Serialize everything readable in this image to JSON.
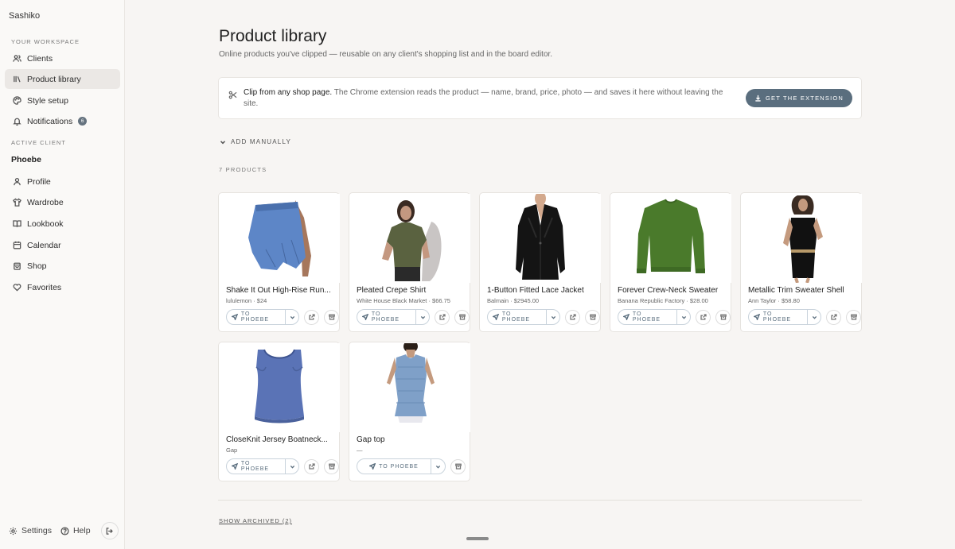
{
  "app": {
    "brand": "Sashiko"
  },
  "sidebar": {
    "workspace_label": "YOUR WORKSPACE",
    "workspace_items": [
      {
        "label": "Clients",
        "icon": "users-icon"
      },
      {
        "label": "Product library",
        "icon": "library-icon",
        "active": true
      },
      {
        "label": "Style setup",
        "icon": "palette-icon"
      },
      {
        "label": "Notifications",
        "icon": "bell-icon",
        "badge": "6"
      }
    ],
    "active_client_label": "ACTIVE CLIENT",
    "client_name": "Phoebe",
    "client_items": [
      {
        "label": "Profile",
        "icon": "user-icon"
      },
      {
        "label": "Wardrobe",
        "icon": "shirt-icon"
      },
      {
        "label": "Lookbook",
        "icon": "book-icon"
      },
      {
        "label": "Calendar",
        "icon": "calendar-icon"
      },
      {
        "label": "Shop",
        "icon": "shopping-bag-icon"
      },
      {
        "label": "Favorites",
        "icon": "heart-icon"
      }
    ],
    "footer": {
      "settings": "Settings",
      "help": "Help"
    }
  },
  "page": {
    "title": "Product library",
    "subtitle": "Online products you've clipped — reusable on any client's shopping list and in the board editor."
  },
  "banner": {
    "lead": "Clip from any shop page.",
    "text": " The Chrome extension reads the product — name, brand, price, photo — and saves it here without leaving the site.",
    "button": "GET THE EXTENSION"
  },
  "add_manually": "ADD MANUALLY",
  "product_count": "7 PRODUCTS",
  "products": [
    {
      "name": "Shake It Out High-Rise Run...",
      "meta": "lululemon · $24",
      "send_label": "TO PHOEBE",
      "image": "blue-shorts"
    },
    {
      "name": "Pleated Crepe Shirt",
      "meta": "White House Black Market · $66.75",
      "send_label": "TO PHOEBE",
      "image": "olive-shirt"
    },
    {
      "name": "1-Button Fitted Lace Jacket",
      "meta": "Balmain · $2945.00",
      "send_label": "TO PHOEBE",
      "image": "black-jacket"
    },
    {
      "name": "Forever Crew-Neck Sweater",
      "meta": "Banana Republic Factory · $28.00",
      "send_label": "TO PHOEBE",
      "image": "green-sweater"
    },
    {
      "name": "Metallic Trim Sweater Shell",
      "meta": "Ann Taylor · $58.80",
      "send_label": "TO PHOEBE",
      "image": "black-shell"
    },
    {
      "name": "CloseKnit Jersey Boatneck...",
      "meta": "Gap",
      "send_label": "TO PHOEBE",
      "image": "blue-tank"
    },
    {
      "name": "Gap top",
      "meta": "—",
      "send_label": "TO PHOEBE",
      "image": "blue-knit-top"
    }
  ],
  "show_archived": "SHOW ARCHIVED (2)",
  "colors": {
    "accent": "#5a6e7e",
    "background": "#f7f5f3",
    "sidebar_active": "#ebe8e5"
  }
}
